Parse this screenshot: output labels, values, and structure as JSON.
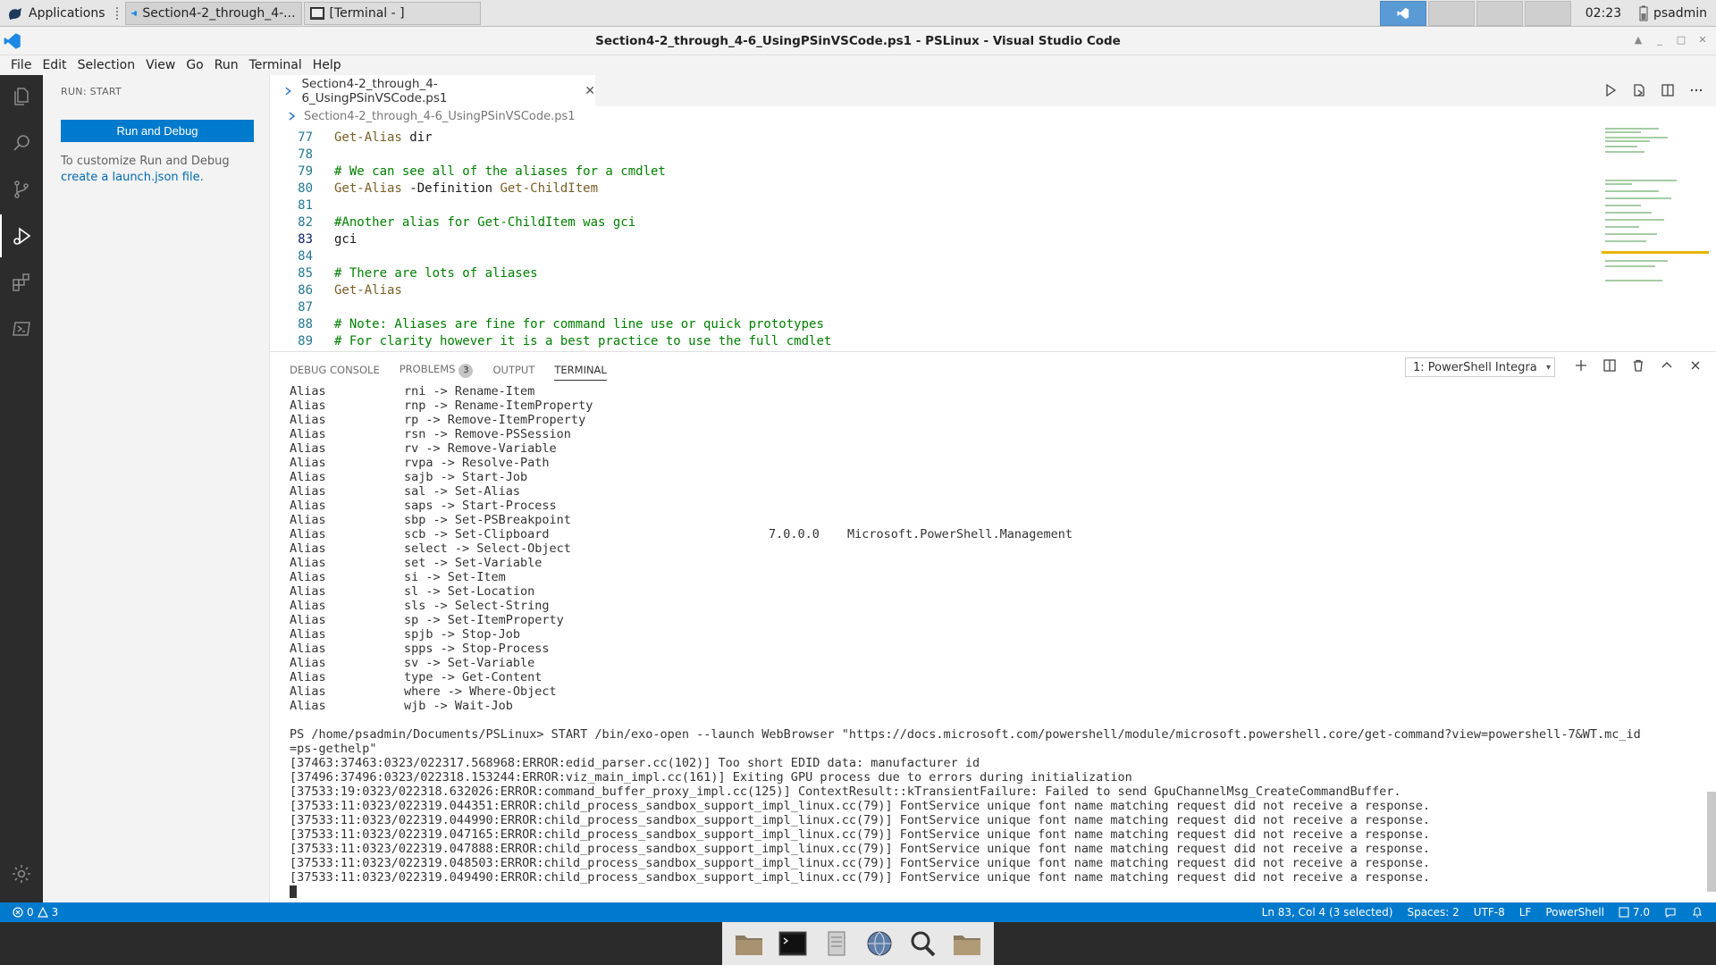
{
  "top_panel": {
    "applications_label": "Applications",
    "tasks": [
      {
        "label": "Section4-2_through_4-..."
      },
      {
        "label": "[Terminal - ]"
      }
    ],
    "clock": "02:23",
    "user": "psadmin"
  },
  "window": {
    "title": "Section4-2_through_4-6_UsingPSinVSCode.ps1 - PSLinux - Visual Studio Code"
  },
  "menu": [
    "File",
    "Edit",
    "Selection",
    "View",
    "Go",
    "Run",
    "Terminal",
    "Help"
  ],
  "sidebar": {
    "title": "RUN: START",
    "run_button": "Run and Debug",
    "hint_text": "To customize Run and Debug",
    "hint_link": "create a launch.json file."
  },
  "editor": {
    "tab_label": "Section4-2_through_4-6_UsingPSinVSCode.ps1",
    "breadcrumb": "Section4-2_through_4-6_UsingPSinVSCode.ps1",
    "lines": [
      {
        "n": "77",
        "code": [
          {
            "t": "Get-Alias",
            "c": "c-cmd"
          },
          {
            "t": " dir",
            "c": "c-str"
          }
        ]
      },
      {
        "n": "78",
        "code": []
      },
      {
        "n": "79",
        "code": [
          {
            "t": "# We can see all of the aliases for a cmdlet",
            "c": "c-cmt"
          }
        ]
      },
      {
        "n": "80",
        "code": [
          {
            "t": "Get-Alias",
            "c": "c-cmd"
          },
          {
            "t": " -Definition ",
            "c": "c-param"
          },
          {
            "t": "Get-ChildItem",
            "c": "c-cmd"
          }
        ]
      },
      {
        "n": "81",
        "code": []
      },
      {
        "n": "82",
        "code": [
          {
            "t": "#Another alias for Get-ChildItem was gci",
            "c": "c-cmt"
          }
        ]
      },
      {
        "n": "83",
        "code": [
          {
            "t": "gci",
            "c": "c-str"
          }
        ]
      },
      {
        "n": "84",
        "code": []
      },
      {
        "n": "85",
        "code": [
          {
            "t": "# There are lots of aliases",
            "c": "c-cmt"
          }
        ]
      },
      {
        "n": "86",
        "code": [
          {
            "t": "Get-Alias",
            "c": "c-cmd"
          }
        ]
      },
      {
        "n": "87",
        "code": []
      },
      {
        "n": "88",
        "code": [
          {
            "t": "# Note: Aliases are fine for command line use or quick prototypes",
            "c": "c-cmt"
          }
        ]
      },
      {
        "n": "89",
        "code": [
          {
            "t": "# For clarity however it is a best practice to use the full cmdlet",
            "c": "c-cmt"
          }
        ]
      }
    ]
  },
  "panel": {
    "tabs": [
      "DEBUG CONSOLE",
      "PROBLEMS",
      "OUTPUT",
      "TERMINAL"
    ],
    "problems_count": "3",
    "terminal_select": "1: PowerShell Integra"
  },
  "terminal": {
    "aliases": [
      {
        "type": "Alias",
        "def": "rni -> Rename-Item"
      },
      {
        "type": "Alias",
        "def": "rnp -> Rename-ItemProperty"
      },
      {
        "type": "Alias",
        "def": "rp -> Remove-ItemProperty"
      },
      {
        "type": "Alias",
        "def": "rsn -> Remove-PSSession"
      },
      {
        "type": "Alias",
        "def": "rv -> Remove-Variable"
      },
      {
        "type": "Alias",
        "def": "rvpa -> Resolve-Path"
      },
      {
        "type": "Alias",
        "def": "sajb -> Start-Job"
      },
      {
        "type": "Alias",
        "def": "sal -> Set-Alias"
      },
      {
        "type": "Alias",
        "def": "saps -> Start-Process"
      },
      {
        "type": "Alias",
        "def": "sbp -> Set-PSBreakpoint"
      },
      {
        "type": "Alias",
        "def": "scb -> Set-Clipboard",
        "version": "7.0.0.0",
        "source": "Microsoft.PowerShell.Management"
      },
      {
        "type": "Alias",
        "def": "select -> Select-Object"
      },
      {
        "type": "Alias",
        "def": "set -> Set-Variable"
      },
      {
        "type": "Alias",
        "def": "si -> Set-Item"
      },
      {
        "type": "Alias",
        "def": "sl -> Set-Location"
      },
      {
        "type": "Alias",
        "def": "sls -> Select-String"
      },
      {
        "type": "Alias",
        "def": "sp -> Set-ItemProperty"
      },
      {
        "type": "Alias",
        "def": "spjb -> Stop-Job"
      },
      {
        "type": "Alias",
        "def": "spps -> Stop-Process"
      },
      {
        "type": "Alias",
        "def": "sv -> Set-Variable"
      },
      {
        "type": "Alias",
        "def": "type -> Get-Content"
      },
      {
        "type": "Alias",
        "def": "where -> Where-Object"
      },
      {
        "type": "Alias",
        "def": "wjb -> Wait-Job"
      }
    ],
    "output": [
      "PS /home/psadmin/Documents/PSLinux> START /bin/exo-open --launch WebBrowser \"https://docs.microsoft.com/powershell/module/microsoft.powershell.core/get-command?view=powershell-7&WT.mc_id",
      "=ps-gethelp\"",
      "[37463:37463:0323/022317.568968:ERROR:edid_parser.cc(102)] Too short EDID data: manufacturer id",
      "[37496:37496:0323/022318.153244:ERROR:viz_main_impl.cc(161)] Exiting GPU process due to errors during initialization",
      "[37533:19:0323/022318.632026:ERROR:command_buffer_proxy_impl.cc(125)] ContextResult::kTransientFailure: Failed to send GpuChannelMsg_CreateCommandBuffer.",
      "[37533:11:0323/022319.044351:ERROR:child_process_sandbox_support_impl_linux.cc(79)] FontService unique font name matching request did not receive a response.",
      "[37533:11:0323/022319.044990:ERROR:child_process_sandbox_support_impl_linux.cc(79)] FontService unique font name matching request did not receive a response.",
      "[37533:11:0323/022319.047165:ERROR:child_process_sandbox_support_impl_linux.cc(79)] FontService unique font name matching request did not receive a response.",
      "[37533:11:0323/022319.047888:ERROR:child_process_sandbox_support_impl_linux.cc(79)] FontService unique font name matching request did not receive a response.",
      "[37533:11:0323/022319.048503:ERROR:child_process_sandbox_support_impl_linux.cc(79)] FontService unique font name matching request did not receive a response.",
      "[37533:11:0323/022319.049490:ERROR:child_process_sandbox_support_impl_linux.cc(79)] FontService unique font name matching request did not receive a response."
    ]
  },
  "statusbar": {
    "errors": "0",
    "warnings": "3",
    "position": "Ln 83, Col 4 (3 selected)",
    "spaces": "Spaces: 2",
    "encoding": "UTF-8",
    "eol": "LF",
    "language": "PowerShell",
    "ps_version": "7.0"
  },
  "colors": {
    "accent": "#007acc",
    "activity_bar": "#2c2c2c",
    "comment": "#008000"
  }
}
